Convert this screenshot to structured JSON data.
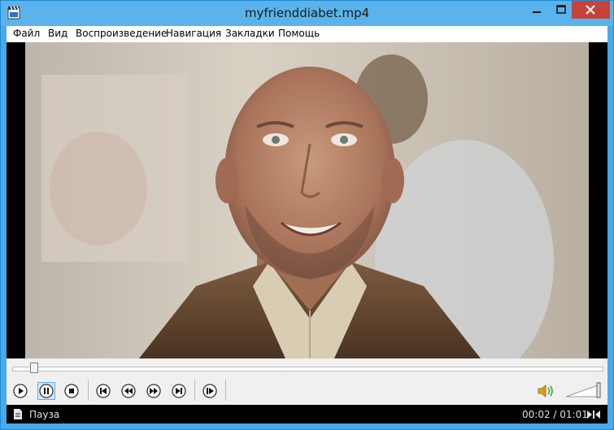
{
  "window": {
    "title": "myfrienddiabet.mp4"
  },
  "menu": [
    "Файл",
    "Вид",
    "Воспроизведение",
    "Навигация",
    "Закладки",
    "Помощь"
  ],
  "icons": {
    "app": "media-player-clapperboard-icon",
    "minimize": "minimize-icon",
    "maximize": "maximize-icon",
    "close": "close-icon",
    "play": "play-icon",
    "pause": "pause-icon",
    "stop": "stop-icon",
    "previous": "skip-previous-icon",
    "rewind": "rewind-icon",
    "forward": "fast-forward-icon",
    "next": "skip-next-icon",
    "frame_step": "frame-step-icon",
    "volume": "speaker-volume-icon",
    "status_file": "document-icon",
    "status_stream": "stream-switch-icon"
  },
  "playback": {
    "position_fraction": 0.03,
    "volume_fraction": 1.0,
    "pause_active": true
  },
  "status": {
    "state": "Пауза",
    "time": "00:02 / 01:01"
  },
  "colors": {
    "title_bar": "#5ab3eb",
    "close_button": "#c7423b",
    "control_bar": "#f0f0f0",
    "status_bar": "#000000",
    "active_button": "#cde8fb"
  }
}
